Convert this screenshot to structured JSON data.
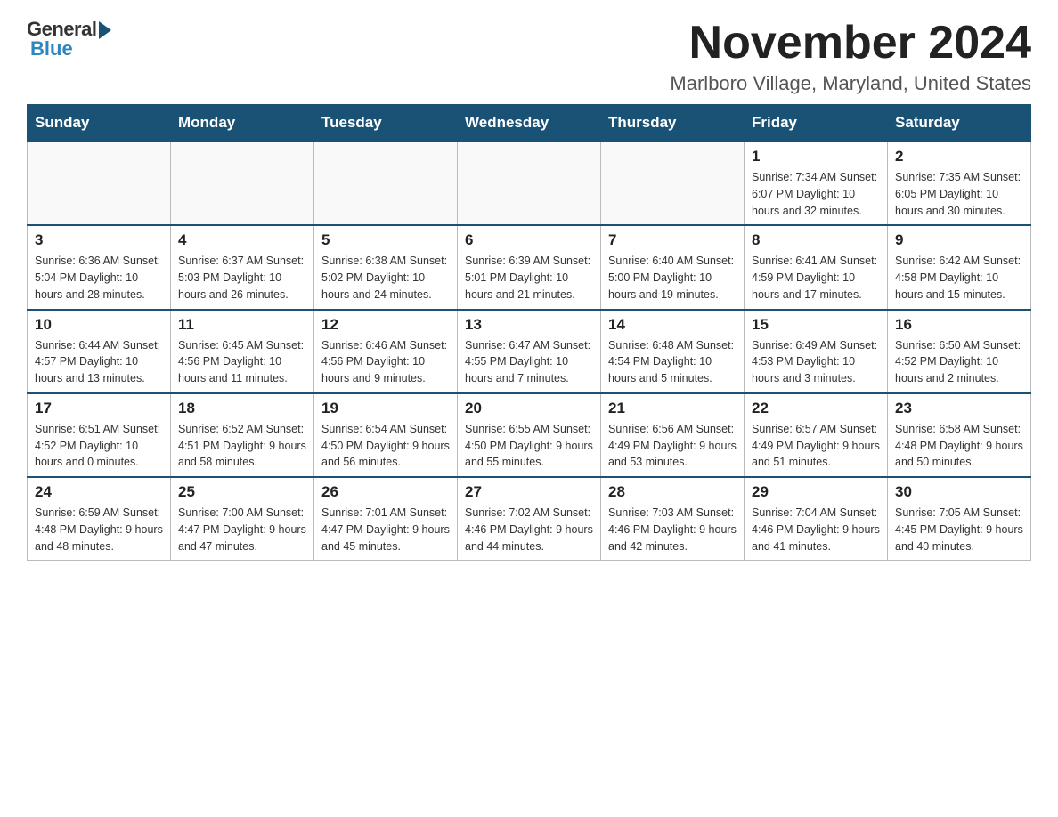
{
  "logo": {
    "general": "General",
    "blue": "Blue"
  },
  "title": "November 2024",
  "subtitle": "Marlboro Village, Maryland, United States",
  "days_of_week": [
    "Sunday",
    "Monday",
    "Tuesday",
    "Wednesday",
    "Thursday",
    "Friday",
    "Saturday"
  ],
  "weeks": [
    [
      {
        "day": "",
        "info": ""
      },
      {
        "day": "",
        "info": ""
      },
      {
        "day": "",
        "info": ""
      },
      {
        "day": "",
        "info": ""
      },
      {
        "day": "",
        "info": ""
      },
      {
        "day": "1",
        "info": "Sunrise: 7:34 AM\nSunset: 6:07 PM\nDaylight: 10 hours and 32 minutes."
      },
      {
        "day": "2",
        "info": "Sunrise: 7:35 AM\nSunset: 6:05 PM\nDaylight: 10 hours and 30 minutes."
      }
    ],
    [
      {
        "day": "3",
        "info": "Sunrise: 6:36 AM\nSunset: 5:04 PM\nDaylight: 10 hours and 28 minutes."
      },
      {
        "day": "4",
        "info": "Sunrise: 6:37 AM\nSunset: 5:03 PM\nDaylight: 10 hours and 26 minutes."
      },
      {
        "day": "5",
        "info": "Sunrise: 6:38 AM\nSunset: 5:02 PM\nDaylight: 10 hours and 24 minutes."
      },
      {
        "day": "6",
        "info": "Sunrise: 6:39 AM\nSunset: 5:01 PM\nDaylight: 10 hours and 21 minutes."
      },
      {
        "day": "7",
        "info": "Sunrise: 6:40 AM\nSunset: 5:00 PM\nDaylight: 10 hours and 19 minutes."
      },
      {
        "day": "8",
        "info": "Sunrise: 6:41 AM\nSunset: 4:59 PM\nDaylight: 10 hours and 17 minutes."
      },
      {
        "day": "9",
        "info": "Sunrise: 6:42 AM\nSunset: 4:58 PM\nDaylight: 10 hours and 15 minutes."
      }
    ],
    [
      {
        "day": "10",
        "info": "Sunrise: 6:44 AM\nSunset: 4:57 PM\nDaylight: 10 hours and 13 minutes."
      },
      {
        "day": "11",
        "info": "Sunrise: 6:45 AM\nSunset: 4:56 PM\nDaylight: 10 hours and 11 minutes."
      },
      {
        "day": "12",
        "info": "Sunrise: 6:46 AM\nSunset: 4:56 PM\nDaylight: 10 hours and 9 minutes."
      },
      {
        "day": "13",
        "info": "Sunrise: 6:47 AM\nSunset: 4:55 PM\nDaylight: 10 hours and 7 minutes."
      },
      {
        "day": "14",
        "info": "Sunrise: 6:48 AM\nSunset: 4:54 PM\nDaylight: 10 hours and 5 minutes."
      },
      {
        "day": "15",
        "info": "Sunrise: 6:49 AM\nSunset: 4:53 PM\nDaylight: 10 hours and 3 minutes."
      },
      {
        "day": "16",
        "info": "Sunrise: 6:50 AM\nSunset: 4:52 PM\nDaylight: 10 hours and 2 minutes."
      }
    ],
    [
      {
        "day": "17",
        "info": "Sunrise: 6:51 AM\nSunset: 4:52 PM\nDaylight: 10 hours and 0 minutes."
      },
      {
        "day": "18",
        "info": "Sunrise: 6:52 AM\nSunset: 4:51 PM\nDaylight: 9 hours and 58 minutes."
      },
      {
        "day": "19",
        "info": "Sunrise: 6:54 AM\nSunset: 4:50 PM\nDaylight: 9 hours and 56 minutes."
      },
      {
        "day": "20",
        "info": "Sunrise: 6:55 AM\nSunset: 4:50 PM\nDaylight: 9 hours and 55 minutes."
      },
      {
        "day": "21",
        "info": "Sunrise: 6:56 AM\nSunset: 4:49 PM\nDaylight: 9 hours and 53 minutes."
      },
      {
        "day": "22",
        "info": "Sunrise: 6:57 AM\nSunset: 4:49 PM\nDaylight: 9 hours and 51 minutes."
      },
      {
        "day": "23",
        "info": "Sunrise: 6:58 AM\nSunset: 4:48 PM\nDaylight: 9 hours and 50 minutes."
      }
    ],
    [
      {
        "day": "24",
        "info": "Sunrise: 6:59 AM\nSunset: 4:48 PM\nDaylight: 9 hours and 48 minutes."
      },
      {
        "day": "25",
        "info": "Sunrise: 7:00 AM\nSunset: 4:47 PM\nDaylight: 9 hours and 47 minutes."
      },
      {
        "day": "26",
        "info": "Sunrise: 7:01 AM\nSunset: 4:47 PM\nDaylight: 9 hours and 45 minutes."
      },
      {
        "day": "27",
        "info": "Sunrise: 7:02 AM\nSunset: 4:46 PM\nDaylight: 9 hours and 44 minutes."
      },
      {
        "day": "28",
        "info": "Sunrise: 7:03 AM\nSunset: 4:46 PM\nDaylight: 9 hours and 42 minutes."
      },
      {
        "day": "29",
        "info": "Sunrise: 7:04 AM\nSunset: 4:46 PM\nDaylight: 9 hours and 41 minutes."
      },
      {
        "day": "30",
        "info": "Sunrise: 7:05 AM\nSunset: 4:45 PM\nDaylight: 9 hours and 40 minutes."
      }
    ]
  ]
}
